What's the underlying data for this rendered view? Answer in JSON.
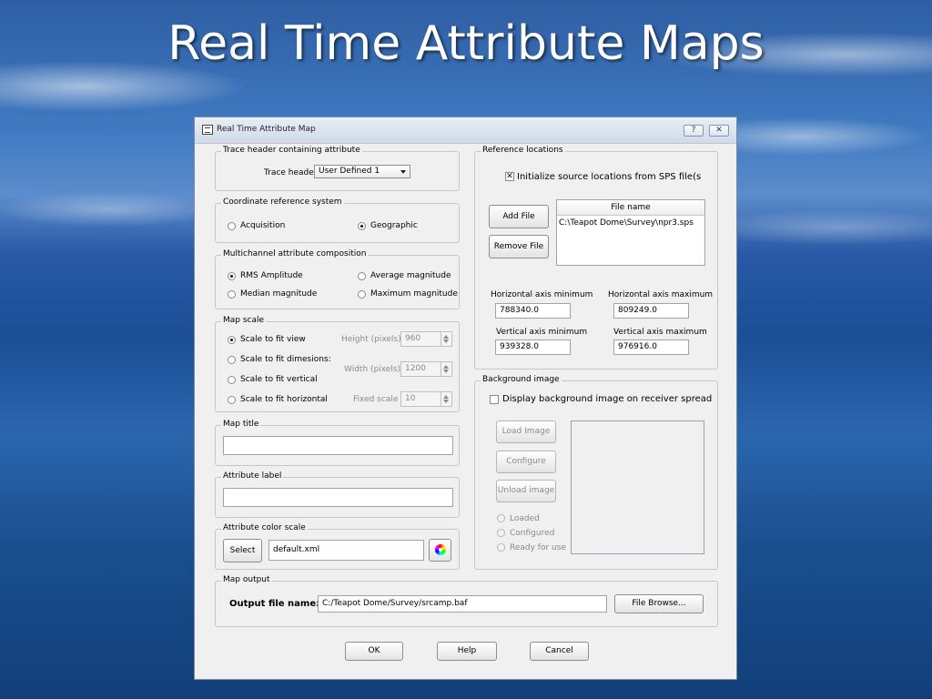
{
  "slide": {
    "title": "Real Time Attribute Maps"
  },
  "dialog": {
    "title": "Real Time Attribute Map",
    "help_label": "?",
    "close_label": "✕",
    "trace_header": {
      "group_title": "Trace header containing attribute",
      "label": "Trace header",
      "selected": "User Defined 1"
    },
    "crs": {
      "group_title": "Coordinate reference system",
      "options": [
        "Acquisition",
        "Geographic"
      ],
      "selected": "Geographic"
    },
    "multichannel": {
      "group_title": "Multichannel attribute composition",
      "options": [
        "RMS Amplitude",
        "Average magnitude",
        "Median magnitude",
        "Maximum magnitude"
      ],
      "selected": "RMS Amplitude"
    },
    "map_scale": {
      "group_title": "Map scale",
      "options": [
        "Scale to fit view",
        "Scale to fit dimesions:",
        "Scale to fit vertical",
        "Scale to fit horizontal"
      ],
      "selected": "Scale to fit view",
      "height_label": "Height (pixels)",
      "height_value": "960",
      "width_label": "Width (pixels)",
      "width_value": "1200",
      "fixed_label": "Fixed scale",
      "fixed_value": "10"
    },
    "map_title": {
      "group_title": "Map title",
      "value": ""
    },
    "attribute_label": {
      "group_title": "Attribute label",
      "value": ""
    },
    "color_scale": {
      "group_title": "Attribute color scale",
      "select_label": "Select",
      "value": "default.xml"
    },
    "reference": {
      "group_title": "Reference locations",
      "init_label": "Initialize source locations from SPS file(s",
      "init_checked": true,
      "add_label": "Add File",
      "remove_label": "Remove File",
      "column_header": "File name",
      "files": [
        "C:\\Teapot Dome\\Survey\\npr3.sps"
      ],
      "h_min_label": "Horizontal axis minimum",
      "h_min_value": "788340.0",
      "h_max_label": "Horizontal axis maximum",
      "h_max_value": "809249.0",
      "v_min_label": "Vertical axis minimum",
      "v_min_value": "939328.0",
      "v_max_label": "Vertical axis maximum",
      "v_max_value": "976916.0"
    },
    "background": {
      "group_title": "Background image",
      "display_label": "Display background image on receiver spread",
      "display_checked": false,
      "load_label": "Load Image",
      "configure_label": "Configure",
      "unload_label": "Unload image",
      "status_options": [
        "Loaded",
        "Configured",
        "Ready for use"
      ]
    },
    "output": {
      "group_title": "Map output",
      "label": "Output file name:",
      "value": "C:/Teapot Dome/Survey/srcamp.baf",
      "browse_label": "File Browse..."
    },
    "footer": {
      "ok_label": "OK",
      "help_label": "Help",
      "cancel_label": "Cancel"
    }
  }
}
